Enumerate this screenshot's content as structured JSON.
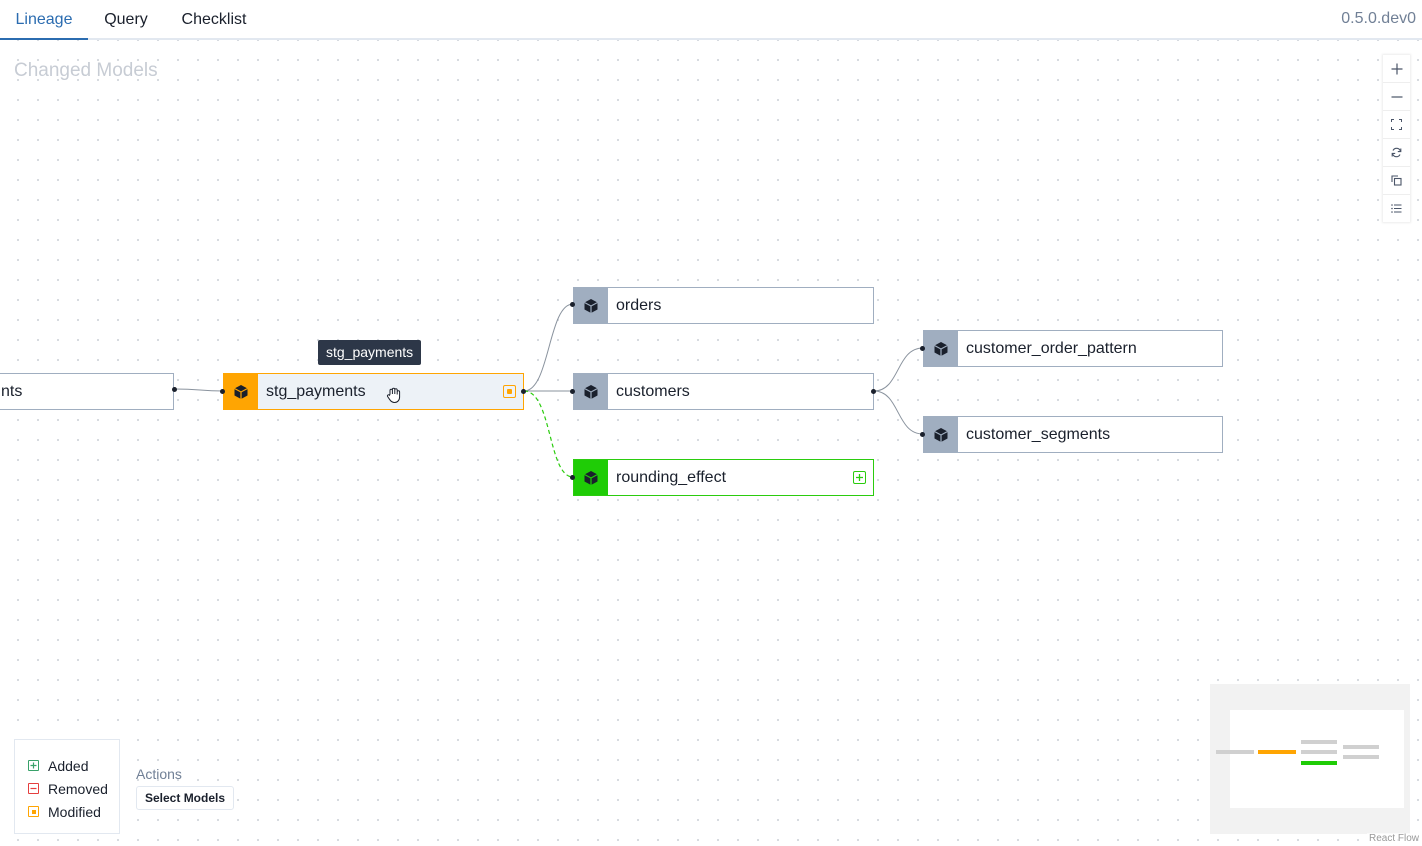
{
  "tabs": [
    {
      "label": "Lineage",
      "active": true
    },
    {
      "label": "Query",
      "active": false
    },
    {
      "label": "Checklist",
      "active": false
    }
  ],
  "version": "0.5.0.dev0",
  "canvas": {
    "title": "Changed Models"
  },
  "nodes": {
    "upstream": {
      "label": "nts",
      "status": "unchanged"
    },
    "stg_payments": {
      "label": "stg_payments",
      "status": "modified"
    },
    "orders": {
      "label": "orders",
      "status": "unchanged"
    },
    "customers": {
      "label": "customers",
      "status": "unchanged"
    },
    "rounding_effect": {
      "label": "rounding_effect",
      "status": "added"
    },
    "customer_order_pattern": {
      "label": "customer_order_pattern",
      "status": "unchanged"
    },
    "customer_segments": {
      "label": "customer_segments",
      "status": "unchanged"
    }
  },
  "tooltip": {
    "text": "stg_payments"
  },
  "controls": [
    "zoom-in-icon",
    "zoom-out-icon",
    "fit-view-icon",
    "refresh-icon",
    "copy-icon",
    "list-icon"
  ],
  "legend": {
    "added": "Added",
    "removed": "Removed",
    "modified": "Modified"
  },
  "actions": {
    "label": "Actions",
    "select_models": "Select Models"
  },
  "attribution": "React Flow",
  "colors": {
    "accent": "#2b6cb0",
    "modified": "#ffa502",
    "added": "#1fcc06",
    "removed": "#e53e3e",
    "unchanged": "#a0aec0"
  }
}
